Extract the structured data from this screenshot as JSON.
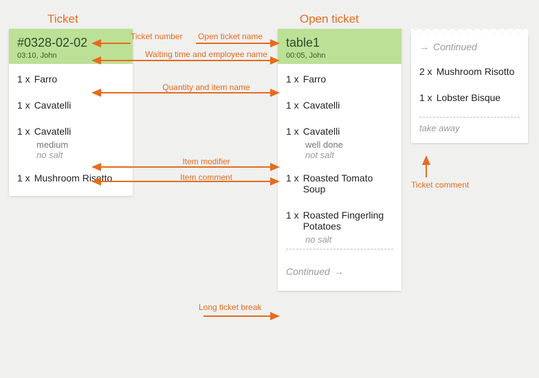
{
  "titles": {
    "left": "Ticket",
    "right": "Open ticket"
  },
  "annotations": {
    "ticket_number": "Ticket number",
    "open_name": "Open ticket name",
    "waiting_emp": "Waiting time and employee name",
    "qty_item": "Quantity and item name",
    "item_modifier": "Item modifier",
    "item_comment": "Item comment",
    "long_break": "Long ticket break",
    "ticket_comment": "Ticket comment"
  },
  "left": {
    "header_main": "#0328-02-02",
    "header_sub": "03:10, John",
    "items": [
      {
        "qty": "1 x",
        "name": "Farro"
      },
      {
        "qty": "1 x",
        "name": "Cavatelli"
      },
      {
        "qty": "1 x",
        "name": "Cavatelli",
        "modifier": "medium",
        "comment": "no salt"
      },
      {
        "qty": "1 x",
        "name": "Mushroom Risotto"
      }
    ]
  },
  "mid": {
    "header_main": "table1",
    "header_sub": "00:05, John",
    "items": [
      {
        "qty": "1 x",
        "name": "Farro"
      },
      {
        "qty": "1 x",
        "name": "Cavatelli"
      },
      {
        "qty": "1 x",
        "name": "Cavatelli",
        "modifier": "well done",
        "comment": "not salt"
      },
      {
        "qty": "1 x",
        "name": "Roasted Tomato Soup"
      },
      {
        "qty": "1 x",
        "name": "Roasted Fingerling Potatoes",
        "comment": "no salt"
      }
    ],
    "cont": "Continued",
    "cont_arrow": "→"
  },
  "right": {
    "cont_arrow": "→",
    "cont": "Continued",
    "items": [
      {
        "qty": "2 x",
        "name": "Mushroom Risotto"
      },
      {
        "qty": "1 x",
        "name": "Lobster Bisque"
      }
    ],
    "ticket_comment": "take away"
  }
}
